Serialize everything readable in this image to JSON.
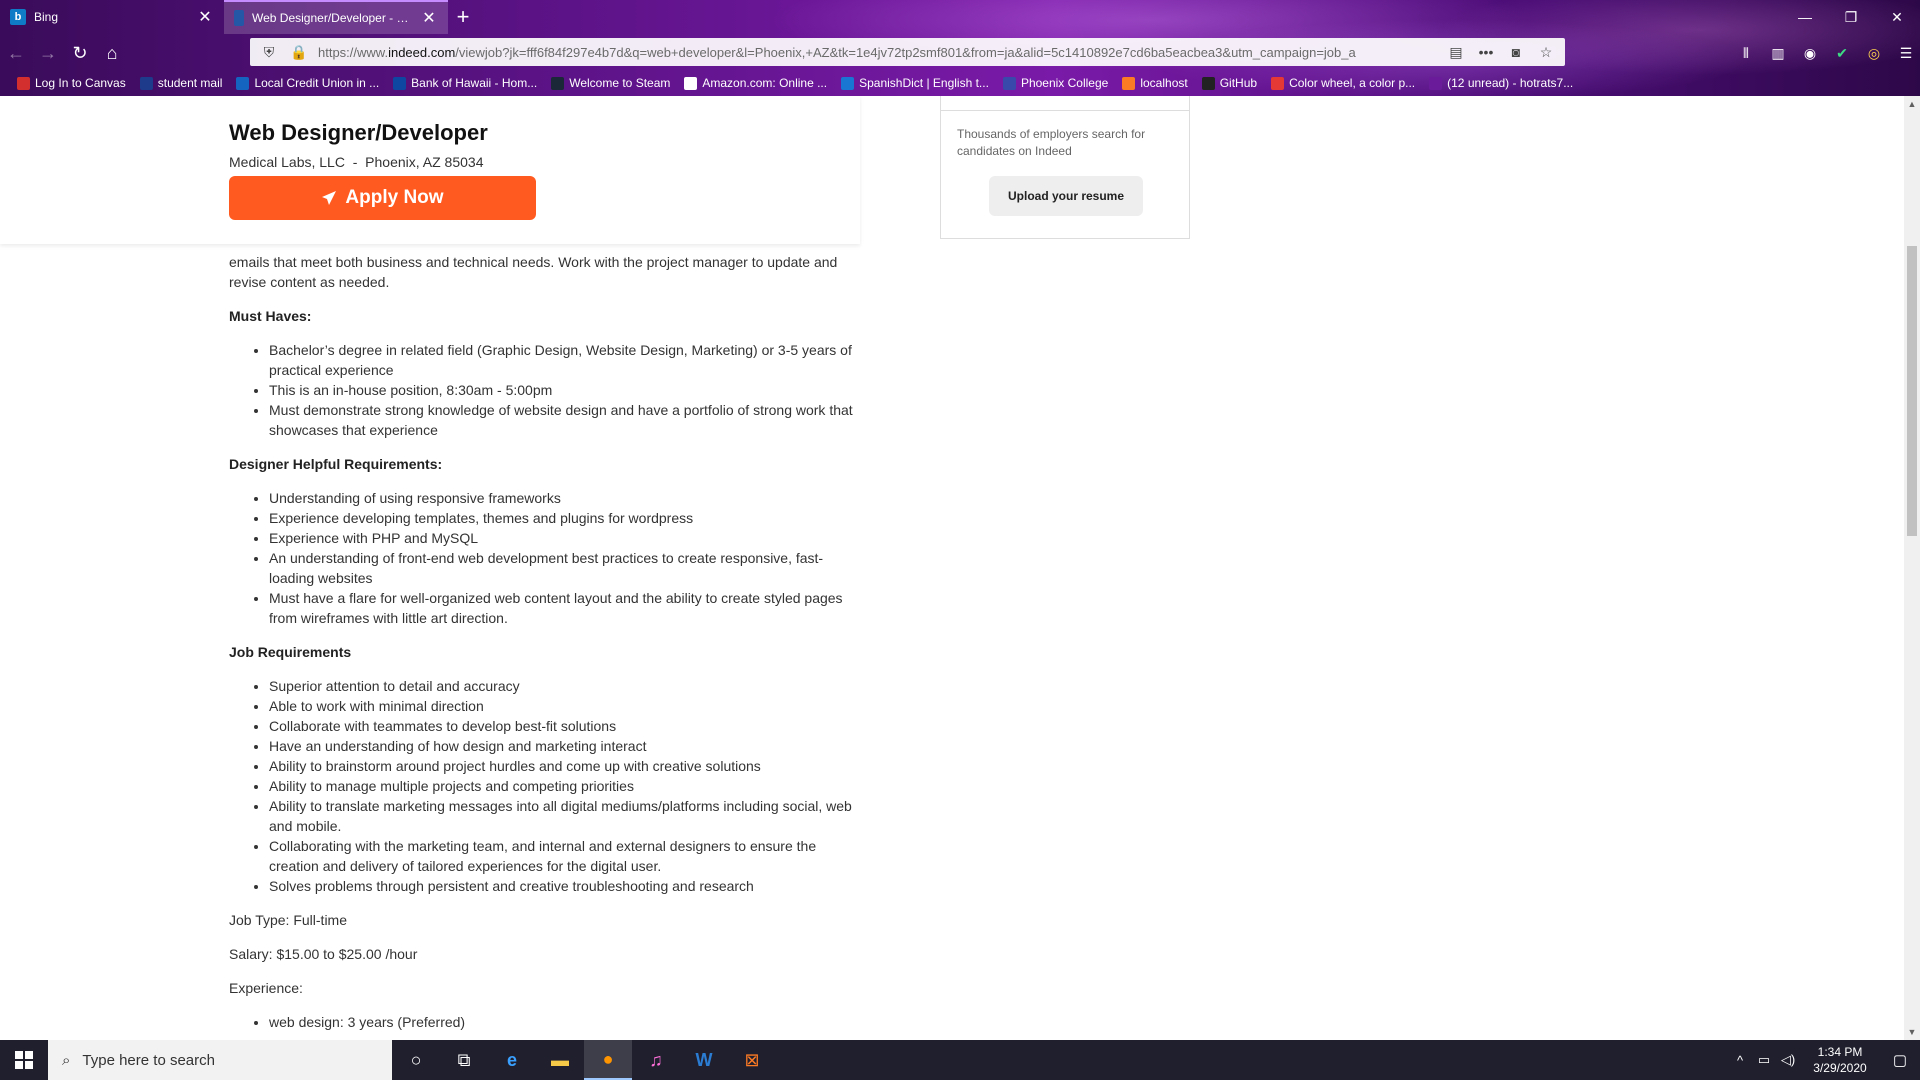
{
  "browser": {
    "tabs": [
      {
        "title": "Bing",
        "favicon": "bing-icon",
        "active": false
      },
      {
        "title": "Web Designer/Developer - Pho",
        "favicon": "indeed-icon",
        "active": true
      }
    ],
    "url_prefix": "https://www.",
    "url_domain": "indeed.com",
    "url_rest": "/viewjob?jk=fff6f84f297e4b7d&q=web+developer&l=Phoenix,+AZ&tk=1e4jv72tp2smf801&from=ja&alid=5c1410892e7cd6ba5eacbea3&utm_campaign=job_a",
    "bookmarks": [
      {
        "label": "Log In to Canvas",
        "color": "#d32f2f"
      },
      {
        "label": "student mail",
        "color": "#1e3a8a"
      },
      {
        "label": "Local Credit Union in ...",
        "color": "#1565c0"
      },
      {
        "label": "Bank of Hawaii - Hom...",
        "color": "#0d47a1"
      },
      {
        "label": "Welcome to Steam",
        "color": "#1b2838"
      },
      {
        "label": "Amazon.com: Online ...",
        "color": "#ffffff"
      },
      {
        "label": "SpanishDict | English t...",
        "color": "#1976d2"
      },
      {
        "label": "Phoenix College",
        "color": "#3949ab"
      },
      {
        "label": "localhost",
        "color": "#fb7a24"
      },
      {
        "label": "GitHub",
        "color": "#222222"
      },
      {
        "label": "Color wheel, a color p...",
        "color": "#e53935"
      },
      {
        "label": "(12 unread) - hotrats7...",
        "color": "#6a1b9a"
      }
    ]
  },
  "job": {
    "title": "Web Designer/Developer",
    "company_line": "Medical Labs, LLC  -  Phoenix, AZ 85034",
    "apply_label": "Apply Now",
    "intro": "emails that meet both business and technical needs. Work with the project manager to update and revise content as needed.",
    "sections": [
      {
        "heading": "Must Haves:",
        "items": [
          "Bachelor’s degree in related field (Graphic Design, Website Design, Marketing) or 3-5 years of practical experience",
          "This is an in-house position, 8:30am - 5:00pm",
          "Must demonstrate strong knowledge of website design and have a portfolio of strong work that showcases that experience"
        ]
      },
      {
        "heading": "Designer Helpful Requirements:",
        "items": [
          "Understanding of using responsive frameworks",
          "Experience developing templates, themes and plugins for wordpress",
          "Experience with PHP and MySQL",
          "An understanding of front-end web development best practices to create responsive, fast-loading websites",
          "Must have a flare for well-organized web content layout and the ability to create styled pages from wireframes with little art direction."
        ]
      },
      {
        "heading": "Job Requirements",
        "items": [
          "Superior attention to detail and accuracy",
          "Able to work with minimal direction",
          "Collaborate with teammates to develop best-fit solutions",
          "Have an understanding of how design and marketing interact",
          "Ability to brainstorm around project hurdles and come up with creative solutions",
          "Ability to manage multiple projects and competing priorities",
          "Ability to translate marketing messages into all digital mediums/platforms including social, web and mobile.",
          "Collaborating with the marketing team, and internal and external designers to ensure the creation and delivery of tailored experiences for the digital user.",
          "Solves problems through persistent and creative troubleshooting and research"
        ]
      }
    ],
    "job_type": "Job Type: Full-time",
    "salary": "Salary: $15.00 to $25.00 /hour",
    "experience_label": "Experience:",
    "experience_items": [
      "web design: 3 years (Preferred)"
    ]
  },
  "sidebar": {
    "text": "Thousands of employers search for candidates on Indeed",
    "upload_label": "Upload your resume"
  },
  "taskbar": {
    "search_placeholder": "Type here to search",
    "time": "1:34 PM",
    "date": "3/29/2020"
  }
}
